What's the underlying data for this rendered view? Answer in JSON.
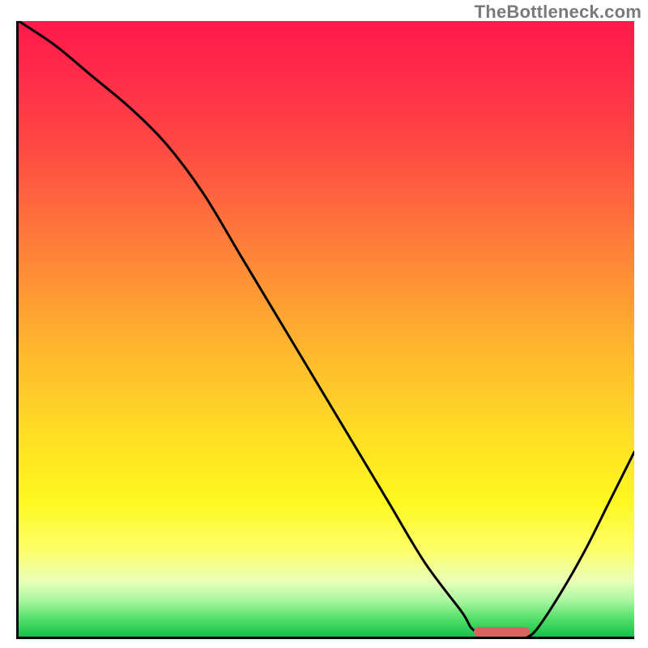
{
  "watermark": "TheBottleneck.com",
  "colors": {
    "axis": "#000000",
    "curve": "#000000",
    "marker": "#d9645f",
    "gradient_top": "#ff1a4b",
    "gradient_bottom": "#12c24a"
  },
  "chart_data": {
    "type": "line",
    "title": "",
    "xlabel": "",
    "ylabel": "",
    "xlim": [
      0,
      100
    ],
    "ylim": [
      0,
      100
    ],
    "grid": false,
    "legend": false,
    "series": [
      {
        "name": "bottleneck-curve",
        "x": [
          0,
          6,
          12,
          18,
          24,
          30,
          36,
          42,
          48,
          54,
          60,
          66,
          72,
          74,
          78,
          82,
          84,
          88,
          92,
          96,
          100
        ],
        "y": [
          100,
          96,
          91,
          86,
          80,
          72,
          62,
          52,
          42,
          32,
          22,
          12,
          4,
          1,
          0,
          0,
          1,
          7,
          14,
          22,
          30
        ]
      }
    ],
    "marker": {
      "x_start": 74,
      "x_end": 83,
      "y": 0.8
    },
    "background": "vertical-gradient red→yellow→green"
  }
}
